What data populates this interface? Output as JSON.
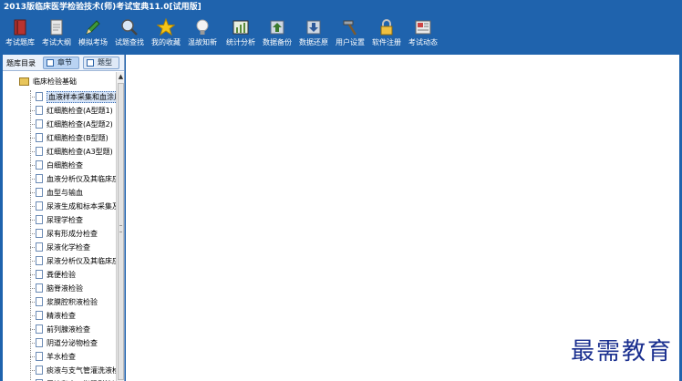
{
  "window": {
    "title": "2013版临床医学检验技术(师)考试宝典11.0[试用版]"
  },
  "toolbar": [
    {
      "label": "考试题库",
      "icon": "book-icon",
      "color": "#b8332f"
    },
    {
      "label": "考试大纲",
      "icon": "document-icon",
      "color": "#e8e8e8"
    },
    {
      "label": "模拟考场",
      "icon": "pencil-icon",
      "color": "#3d9a3a"
    },
    {
      "label": "试题查找",
      "icon": "magnifier-icon",
      "color": "#d9e7f5"
    },
    {
      "label": "我的收藏",
      "icon": "star-icon",
      "color": "#f5c518"
    },
    {
      "label": "温故知新",
      "icon": "lightbulb-icon",
      "color": "#f3f3f3"
    },
    {
      "label": "统计分析",
      "icon": "chart-icon",
      "color": "#5a8a3a"
    },
    {
      "label": "数据备份",
      "icon": "backup-icon",
      "color": "#cfd8e3"
    },
    {
      "label": "数据还原",
      "icon": "restore-icon",
      "color": "#cfd8e3"
    },
    {
      "label": "用户设置",
      "icon": "hammer-icon",
      "color": "#9aa3ad"
    },
    {
      "label": "软件注册",
      "icon": "lock-icon",
      "color": "#f0c040"
    },
    {
      "label": "考试动态",
      "icon": "news-icon",
      "color": "#e9e9e9"
    }
  ],
  "panel": {
    "title": "题库目录",
    "tabs": [
      {
        "label": "章节",
        "active": true
      },
      {
        "label": "题型",
        "active": false
      }
    ]
  },
  "tree": {
    "root": "临床检验基础",
    "items": [
      "血液样本采集和血涂片",
      "红细胞检查(A型题1)",
      "红细胞检查(A型题2)",
      "红细胞检查(B型题)",
      "红细胞检查(A3型题)",
      "白细胞检查",
      "血液分析仪及其临床应",
      "血型与输血",
      "尿液生成和标本采集及",
      "尿理学检查",
      "尿有形成分检查",
      "尿液化学检查",
      "尿液分析仪及其临床应",
      "粪便检验",
      "脑脊液检验",
      "浆膜腔积液检验",
      "精液检查",
      "前列腺液检查",
      "阴道分泌物检查",
      "羊水检查",
      "痰液与支气管灌洗液检",
      "胃液和十二指肠引流液"
    ]
  },
  "watermark": "最需教育"
}
